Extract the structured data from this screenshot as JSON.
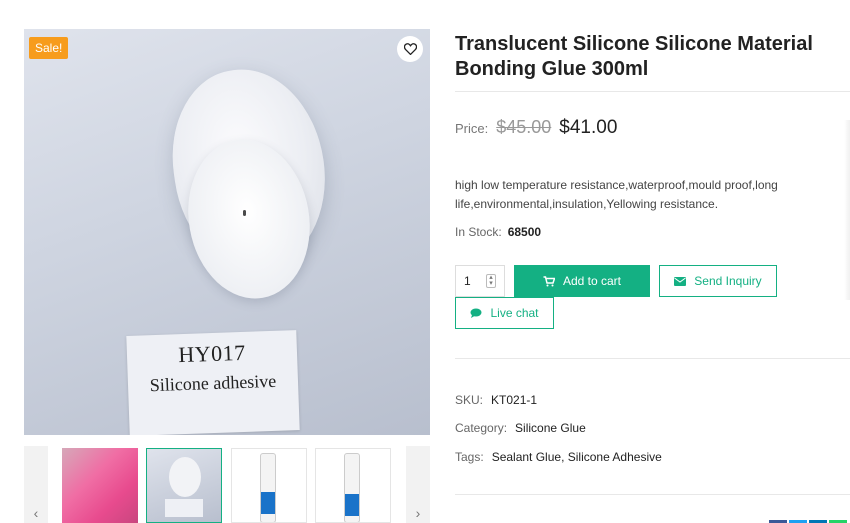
{
  "product": {
    "title": "Translucent Silicone Silicone Material Bonding Glue 300ml",
    "sale_badge": "Sale!",
    "image_label_code": "HY017",
    "image_label_name": "Silicone adhesive",
    "price_label": "Price:",
    "price_old": "$45.00",
    "price_new": "$41.00",
    "description": "high low temperature resistance,waterproof,mould proof,long life,environmental,insulation,Yellowing resistance.",
    "stock_label": "In Stock:",
    "stock_value": "68500",
    "quantity": "1",
    "add_to_cart": "Add to cart",
    "send_inquiry": "Send Inquiry",
    "live_chat": "Live chat",
    "sku_label": "SKU:",
    "sku_value": "KT021-1",
    "category_label": "Category:",
    "category_value": "Silicone Glue",
    "tags_label": "Tags:",
    "tags_value": "Sealant Glue, Silicone Adhesive"
  },
  "gallery": {
    "prev_arrow": "‹",
    "next_arrow": "›",
    "thumbnails": [
      "pink-cord-thumbnail",
      "silicone-sample-thumbnail",
      "tube-thumbnail",
      "tube-thumbnail"
    ],
    "active_thumbnail": 1
  },
  "colors": {
    "accent": "#14b083",
    "sale": "#f79c1c",
    "text": "#222222"
  },
  "icons": {
    "wishlist": "heart-icon",
    "cart": "cart-icon",
    "inquiry": "envelope-icon",
    "chat": "chat-bubble-icon"
  }
}
